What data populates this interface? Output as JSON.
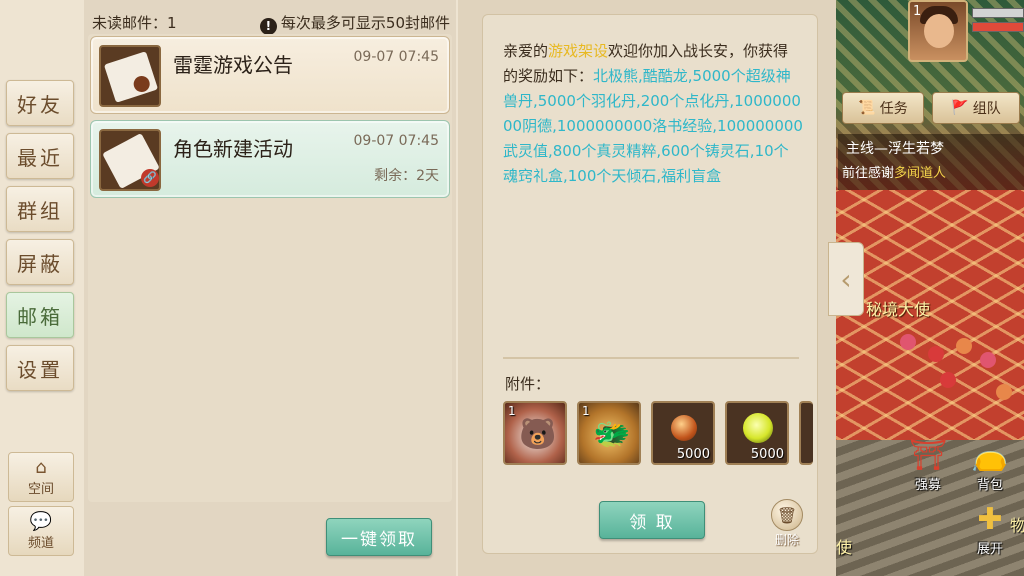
{
  "nav": {
    "items": [
      "好友",
      "最近",
      "群组",
      "屏蔽",
      "邮箱",
      "设置"
    ],
    "active": "邮箱",
    "space_label": "空间",
    "channel_label": "频道"
  },
  "mail_list": {
    "unread_label": "未读邮件：1",
    "max_note": "每次最多可显示50封邮件",
    "items": [
      {
        "title": "雷霆游戏公告",
        "time": "09-07 07:45",
        "remain": ""
      },
      {
        "title": "角色新建活动",
        "time": "09-07 07:45",
        "remain": "剩余：2天"
      }
    ],
    "claim_all_label": "一键领取"
  },
  "message": {
    "greeting_prefix": "亲爱的",
    "player_name": "游戏架设",
    "greeting_suffix": "欢迎你加入战长安，你获得的奖励如下：",
    "rewards": "北极熊,酷酷龙,5000个超级神兽丹,5000个羽化丹,200个点化丹,100000000阴德,1000000000洛书经验,100000000武灵值,800个真灵精粹,600个铸灵石,10个魂窍礼盒,100个天倾石,福利盲盒",
    "attachments_label": "附件：",
    "attachments": [
      {
        "name": "北极熊",
        "num": "1",
        "count": ""
      },
      {
        "name": "酷酷龙",
        "num": "1",
        "count": ""
      },
      {
        "name": "item-3",
        "num": "",
        "count": "5000"
      },
      {
        "name": "item-4",
        "num": "",
        "count": "5000"
      }
    ],
    "claim_label": "领 取",
    "delete_label": "删除"
  },
  "hud": {
    "level": "1",
    "task_tab": "任务",
    "team_tab": "组队",
    "quest_title": "主线—浮生若梦",
    "quest_desc_prefix": "前往感谢",
    "quest_desc_target": "多闻道人",
    "npc_name": "秘境大使",
    "btn_recruit": "强募",
    "btn_bag": "背包",
    "btn_expand": "展开",
    "side_char": "物",
    "bottom_char": "使"
  },
  "colors": {
    "accent_green": "#58b39a",
    "highlight_yellow": "#e8b923",
    "highlight_cyan": "#2fb7c9",
    "text_brown": "#6b4c2c"
  }
}
